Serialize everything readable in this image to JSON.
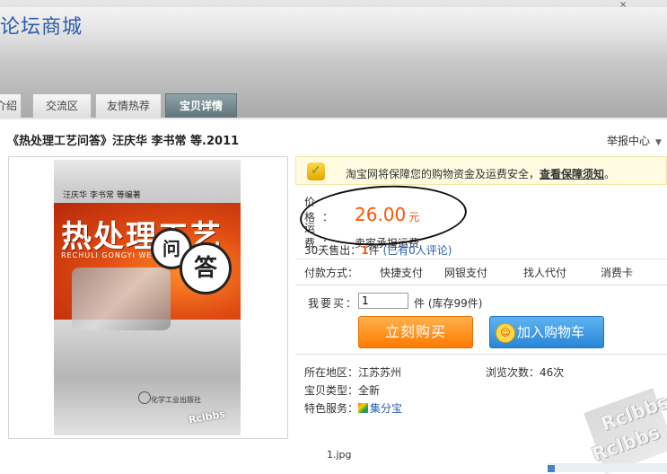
{
  "header": {
    "site_title": "论坛商城",
    "corner_mark": "×"
  },
  "tabs": [
    {
      "label": "介绍",
      "active": false
    },
    {
      "label": "交流区",
      "active": false
    },
    {
      "label": "友情热荐",
      "active": false
    },
    {
      "label": "宝贝详情",
      "active": true
    }
  ],
  "product": {
    "title": "《热处理工艺问答》汪庆华 李书常 等.2011",
    "report_label": "举报中心",
    "image_caption": "1.jpg",
    "cover": {
      "authors": "汪庆华  李书常  等编著",
      "main_title": "热处理工艺",
      "pinyin": "RECHULI GONGYI WENDA",
      "bubble1": "问",
      "bubble2": "答",
      "publisher": "化学工业出版社",
      "watermark": "Rclbbs"
    }
  },
  "guarantee": {
    "text": "淘宝网将保障您的购物资金及运费安全，",
    "link": "查看保障须知",
    "end": "。"
  },
  "price": {
    "label": "价格：",
    "value": "26.00",
    "unit": "元"
  },
  "shipping": {
    "label": "运费：",
    "value": "卖家承担运费"
  },
  "sales": {
    "prefix": "30天售出：",
    "count": "1",
    "unit": "件",
    "comments": "(已有0人评论)"
  },
  "payment": {
    "label": "付款方式：",
    "methods": [
      "快捷支付",
      "网银支付",
      "找人代付",
      "消费卡"
    ]
  },
  "purchase": {
    "qty_label": "我要买：",
    "qty_value": "1",
    "stock": "件 (库存99件)",
    "buy_now": "立刻购买",
    "add_cart": "加入购物车"
  },
  "meta": {
    "location_label": "所在地区：",
    "location": "江苏苏州",
    "views_label": "浏览次数：",
    "views": "46次",
    "type_label": "宝贝类型：",
    "type": "全新",
    "service_label": "特色服务：",
    "service": "集分宝"
  },
  "watermarks": [
    "Rclbbs",
    "Rclbbs"
  ],
  "colors": {
    "accent_orange": "#ff5500",
    "link_blue": "#2a5db0",
    "buy_orange": "#ff7a00",
    "cart_blue": "#2a86d6"
  }
}
